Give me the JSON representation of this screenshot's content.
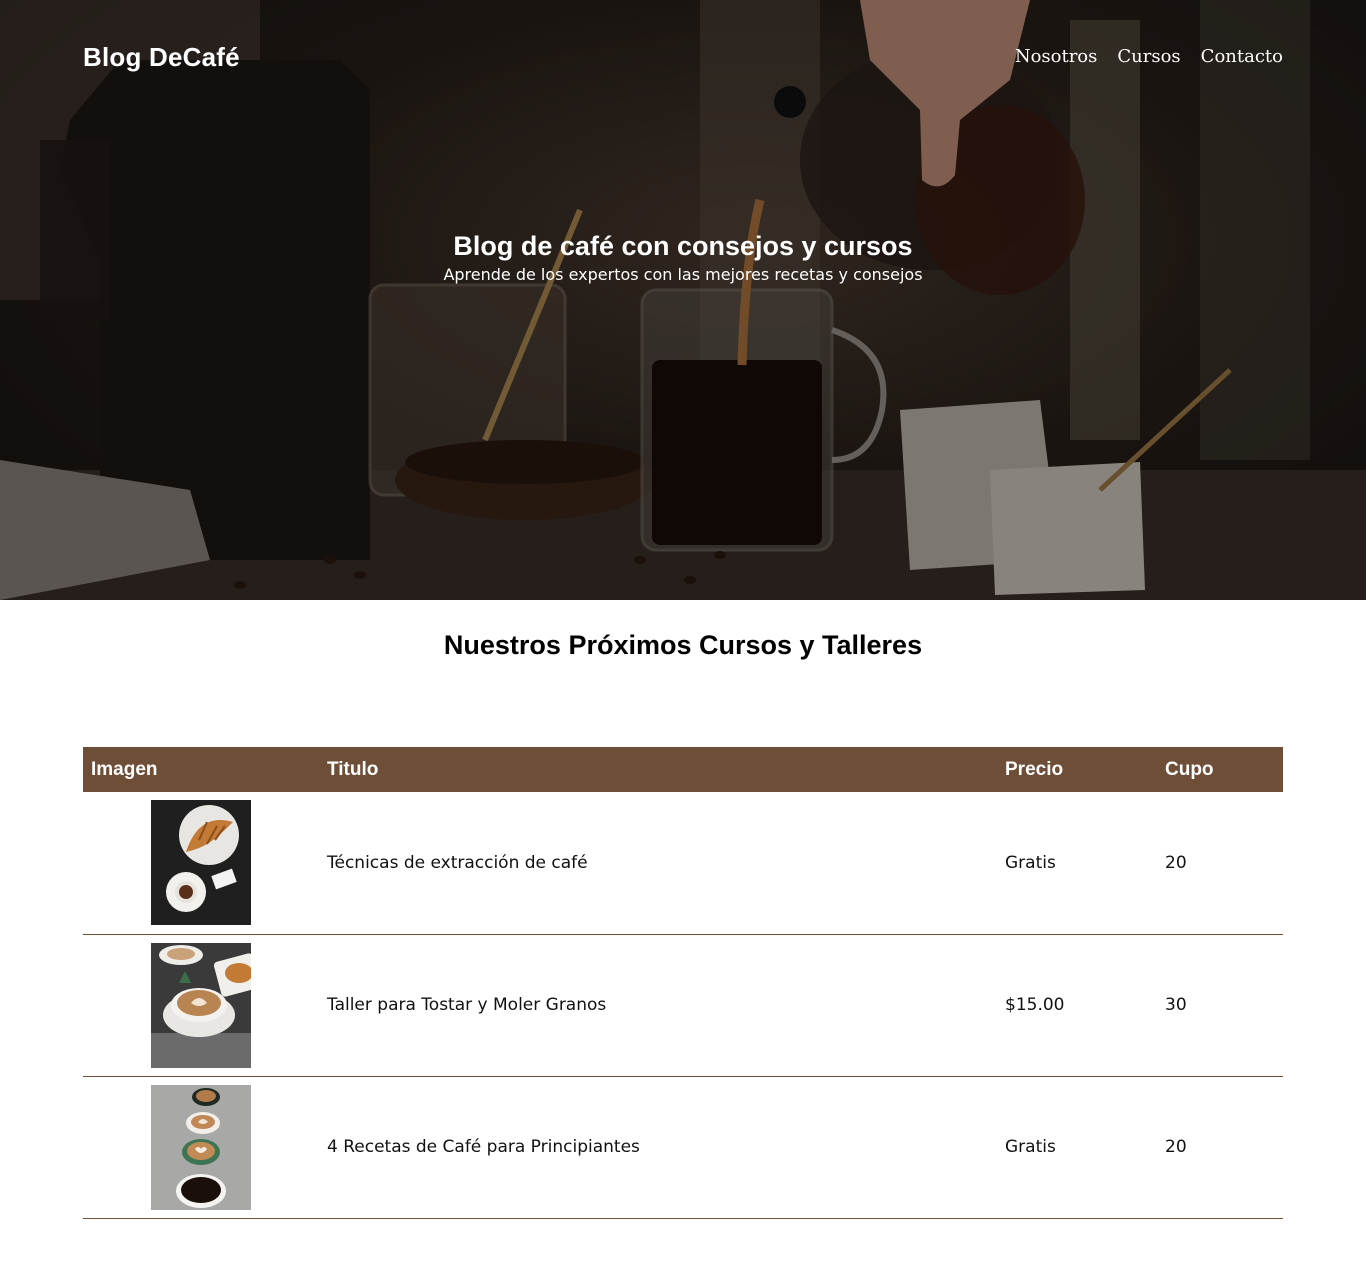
{
  "header": {
    "brand": "Blog DeCafé",
    "nav": [
      {
        "label": "Nosotros"
      },
      {
        "label": "Cursos"
      },
      {
        "label": "Contacto"
      }
    ]
  },
  "hero": {
    "title": "Blog de café con consejos y cursos",
    "subtitle": "Aprende de los expertos con las mejores recetas y consejos",
    "image_icon": "coffee-pouring-photo"
  },
  "courses": {
    "title": "Nuestros Próximos Cursos y Talleres",
    "columns": [
      "Imagen",
      "Titulo",
      "Precio",
      "Cupo"
    ],
    "rows": [
      {
        "image_icon": "croissant-espresso-photo",
        "titulo": "Técnicas de extracción de café",
        "precio": "Gratis",
        "cupo": "20"
      },
      {
        "image_icon": "latte-art-cups-photo",
        "titulo": "Taller para Tostar y Moler Granos",
        "precio": "$15.00",
        "cupo": "30"
      },
      {
        "image_icon": "four-coffee-cups-photo",
        "titulo": "4 Recetas de Café para Principiantes",
        "precio": "Gratis",
        "cupo": "20"
      }
    ]
  },
  "colors": {
    "accent": "#6f4e37",
    "hero_text": "#ffffff"
  }
}
